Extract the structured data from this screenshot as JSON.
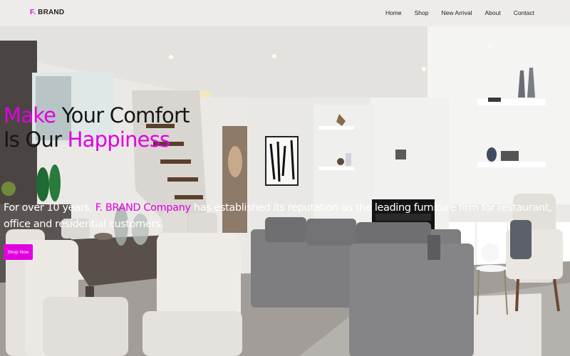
{
  "brand": {
    "prefix": "F.",
    "name": " BRAND"
  },
  "nav": {
    "items": [
      "Home",
      "Shop",
      "New Arrival",
      "About",
      "Contact"
    ]
  },
  "hero": {
    "line1_pink": "Make",
    "line1_rest": " Your Comfort",
    "line2_rest": "Is Our ",
    "line2_pink": "Happiness",
    "sub_before": "For over 10 years, ",
    "sub_pink": "F. BRAND Company",
    "sub_after": " has established its reputation as the leading furniture firm for restaurant, office and residential customers.",
    "button": "Shop Now"
  },
  "colors": {
    "accent": "#e000e0"
  }
}
